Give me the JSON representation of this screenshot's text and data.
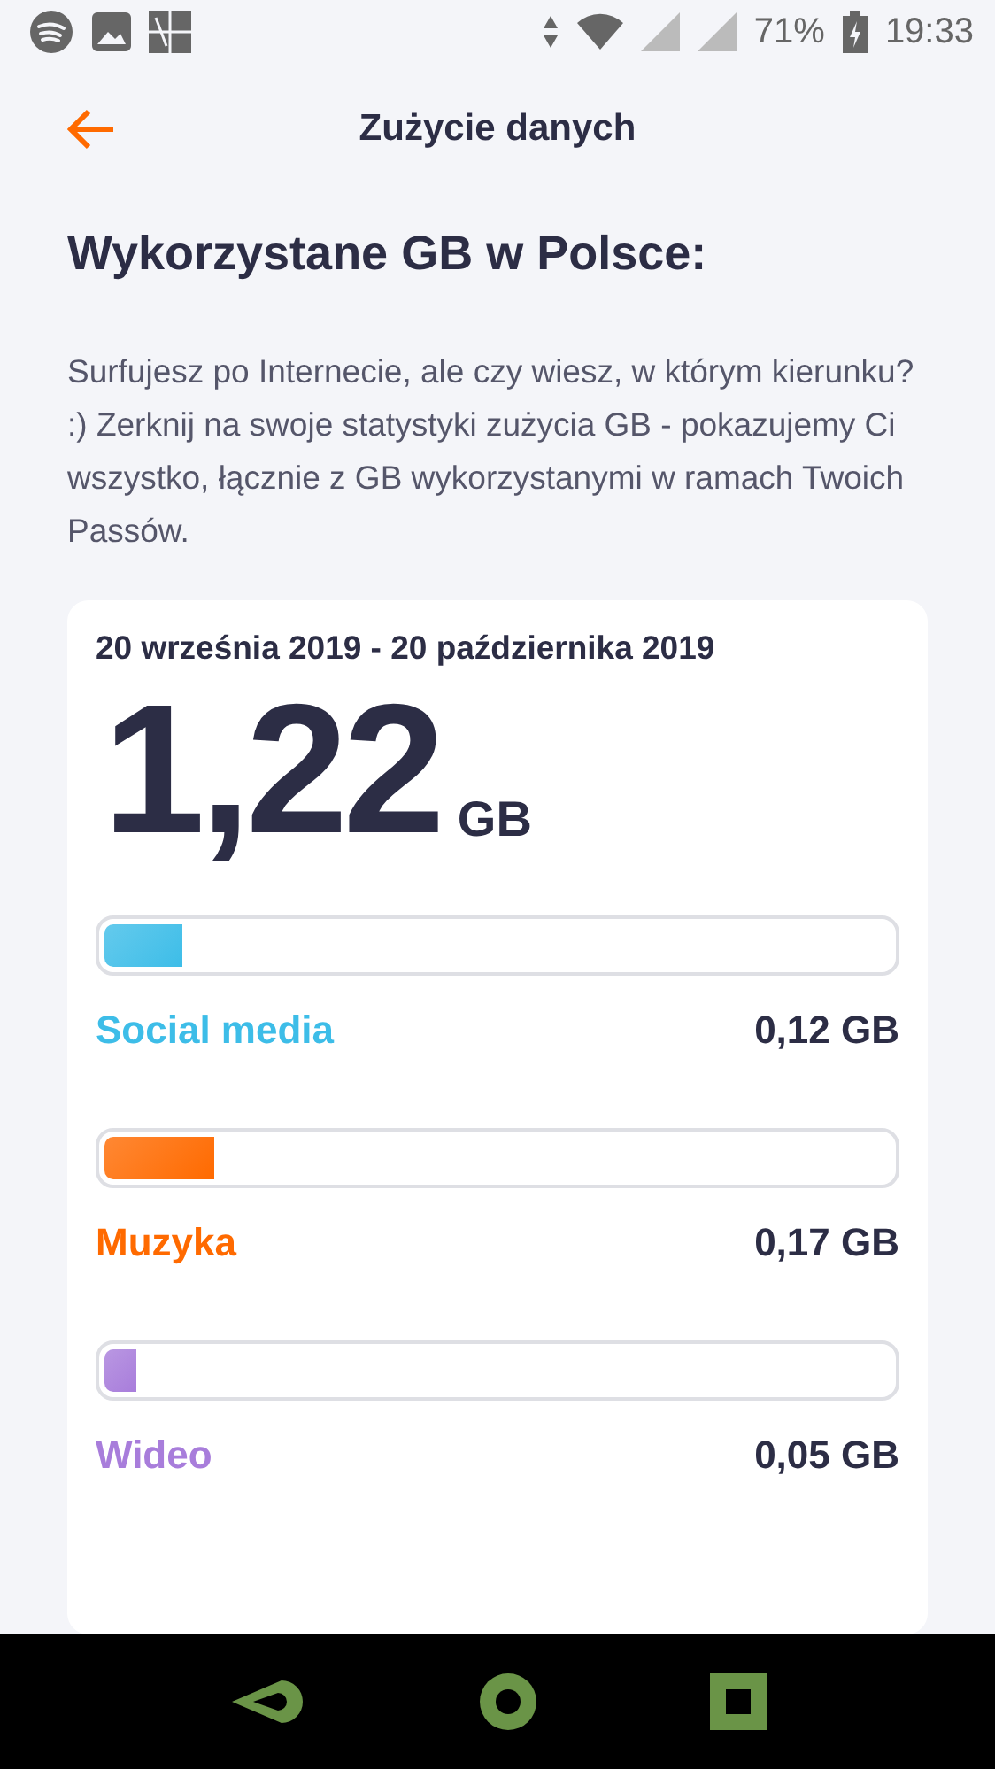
{
  "status_bar": {
    "battery": "71%",
    "time": "19:33"
  },
  "header": {
    "title": "Zużycie danych"
  },
  "heading": "Wykorzystane GB w Polsce:",
  "description": "Surfujesz po Internecie, ale czy wiesz, w którym kierunku? :) Zerknij na swoje statystyki zużycia GB - pokazujemy Ci wszystko, łącznie z GB wykorzystanymi w ramach Twoich Passów.",
  "card": {
    "period": "20 września 2019 - 20 października 2019",
    "total": "1,22",
    "unit": "GB",
    "categories": [
      {
        "name": "Social media",
        "amount": "0,12 GB",
        "level": 0.1,
        "color": "#3dbde8"
      },
      {
        "name": "Muzyka",
        "amount": "0,17 GB",
        "level": 0.14,
        "color": "#ff6a00"
      },
      {
        "name": "Wideo",
        "amount": "0,05 GB",
        "level": 0.04,
        "color": "#a87ddb"
      }
    ]
  }
}
